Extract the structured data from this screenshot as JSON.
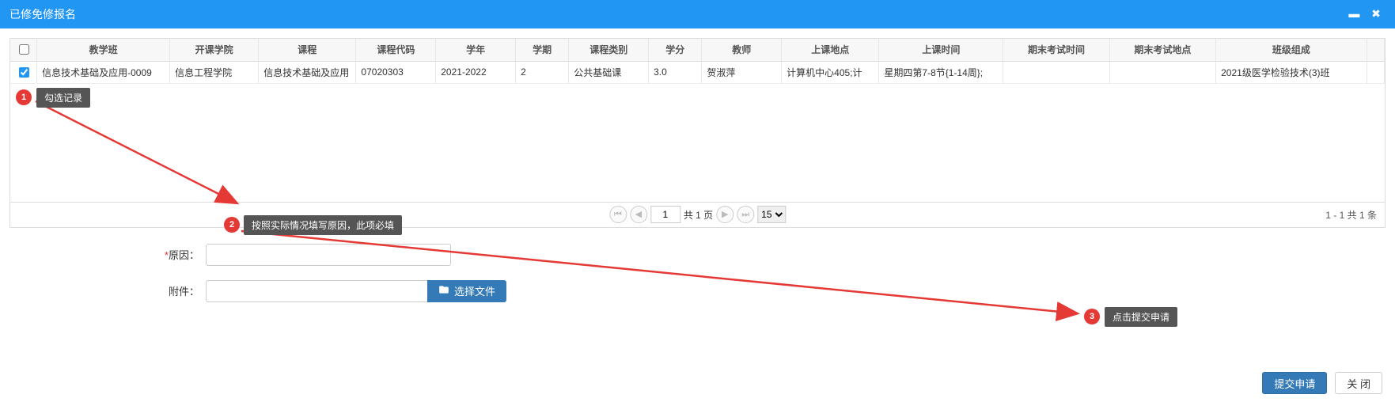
{
  "window": {
    "title": "已修免修报名",
    "minimize_icon": "minimize-icon",
    "close_icon": "close-icon"
  },
  "table": {
    "headers": [
      "教学班",
      "开课学院",
      "课程",
      "课程代码",
      "学年",
      "学期",
      "课程类别",
      "学分",
      "教师",
      "上课地点",
      "上课时间",
      "期末考试时间",
      "期末考试地点",
      "班级组成"
    ],
    "row": {
      "checked": true,
      "cells": [
        "信息技术基础及应用-0009",
        "信息工程学院",
        "信息技术基础及应用",
        "07020303",
        "2021-2022",
        "2",
        "公共基础课",
        "3.0",
        "贺淑萍",
        "计算机中心405;计",
        "星期四第7-8节{1-14周};",
        "",
        "",
        "2021级医学检验技术(3)班"
      ]
    }
  },
  "pager": {
    "page": "1",
    "total_pages_label": "共 1 页",
    "page_size": "15",
    "summary": "1 - 1  共 1 条"
  },
  "form": {
    "reason_label": "原因：",
    "reason_value": "",
    "attachment_label": "附件：",
    "attachment_value": "",
    "choose_file_label": "选择文件"
  },
  "footer": {
    "submit_label": "提交申请",
    "close_label": "关 闭"
  },
  "annotations": {
    "a1_num": "1",
    "a1_label": "勾选记录",
    "a2_num": "2",
    "a2_label": "按照实际情况填写原因，此项必填",
    "a3_num": "3",
    "a3_label": "点击提交申请"
  }
}
